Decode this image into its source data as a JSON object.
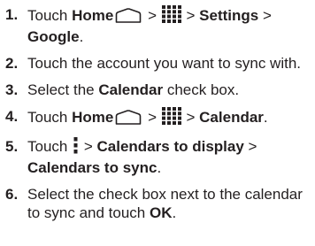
{
  "steps": [
    {
      "num": "1.",
      "touch": "Touch",
      "home": "Home",
      "sep1": ">",
      "sep2": ">",
      "settings": "Settings",
      "sep3": ">",
      "google": "Google",
      "end": "."
    },
    {
      "num": "2.",
      "text": "Touch the account you want to sync with."
    },
    {
      "num": "3.",
      "pre": "Select the",
      "calendar": "Calendar",
      "post": "check box."
    },
    {
      "num": "4.",
      "touch": "Touch",
      "home": "Home",
      "sep1": ">",
      "sep2": ">",
      "calendar": "Calendar",
      "end": "."
    },
    {
      "num": "5.",
      "touch": "Touch",
      "sep1": ">",
      "calendars_display": "Calendars to display",
      "sep2": ">",
      "calendars_sync": "Calendars to sync",
      "end": "."
    },
    {
      "num": "6.",
      "text": "Select the check box next to the calendar to sync and touch",
      "ok": "OK",
      "end": "."
    }
  ],
  "icons": {
    "home": "home-icon",
    "apps": "apps-grid-icon",
    "menu": "overflow-menu-icon"
  }
}
